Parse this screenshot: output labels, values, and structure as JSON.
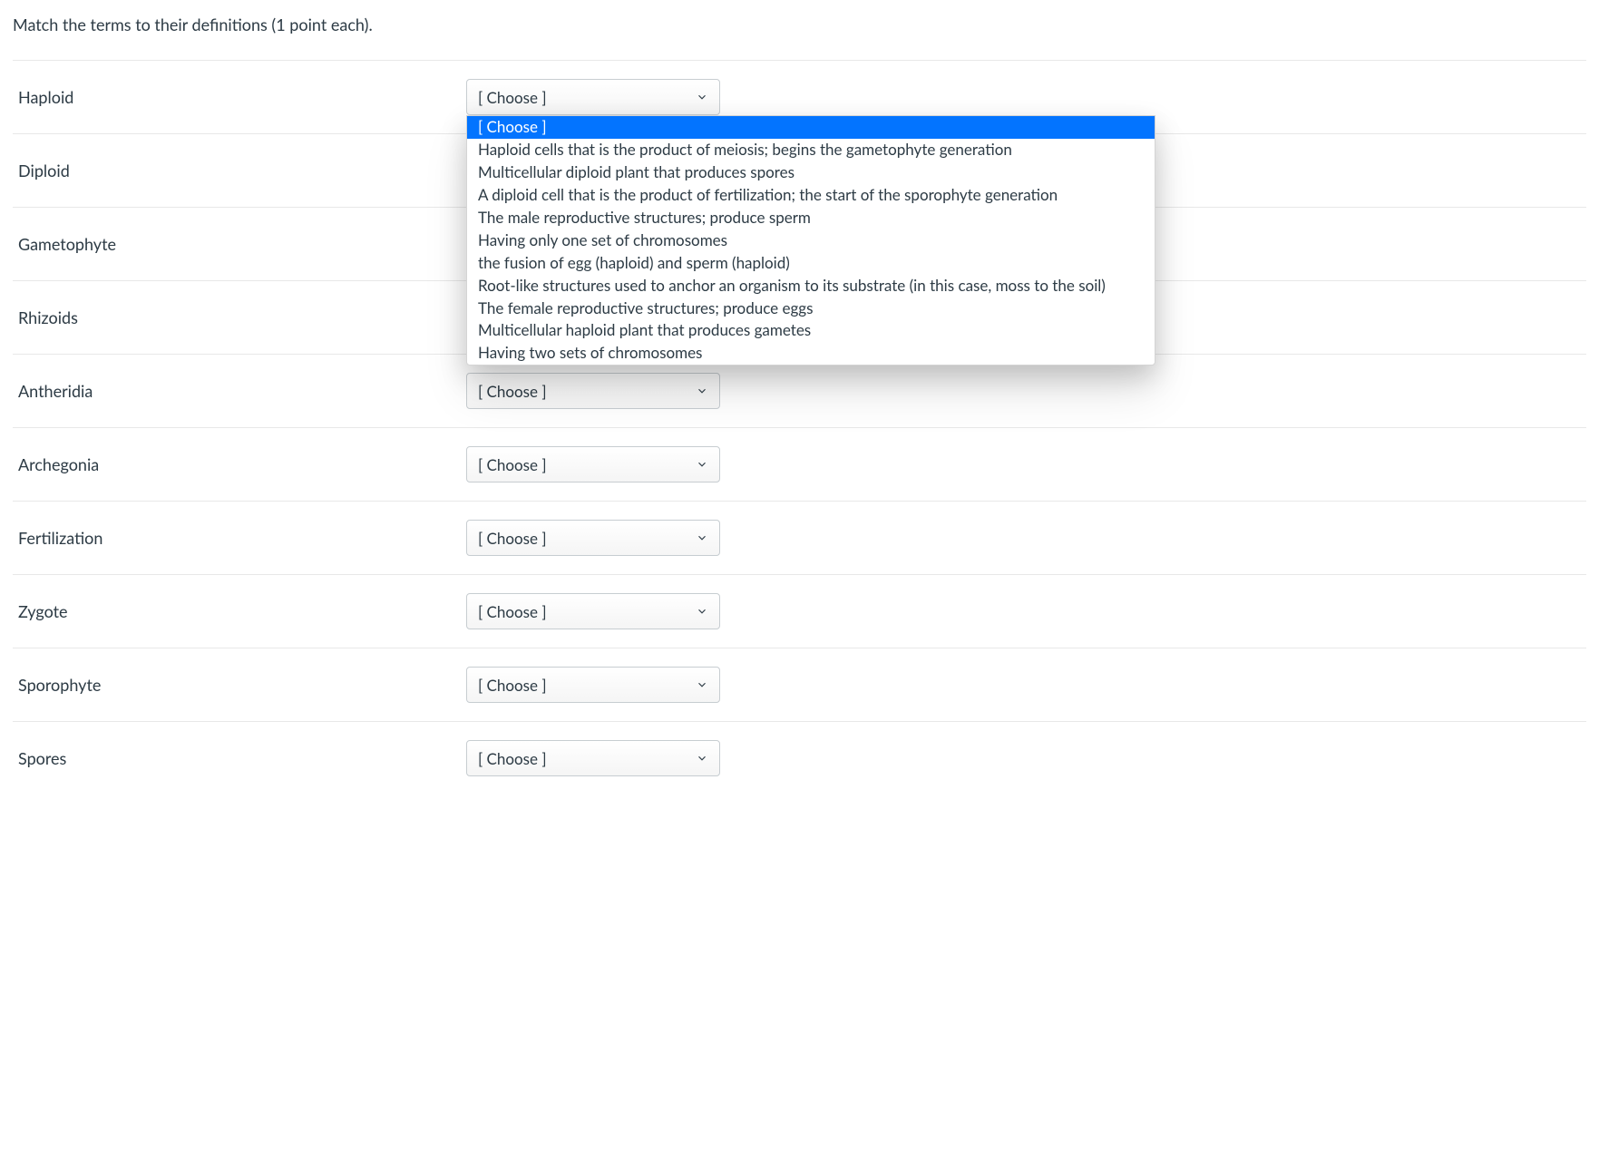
{
  "question": "Match the terms to their definitions (1 point each).",
  "choosePlaceholder": "[ Choose ]",
  "terms": [
    {
      "id": "haploid",
      "label": "Haploid",
      "open": true
    },
    {
      "id": "diploid",
      "label": "Diploid",
      "open": false
    },
    {
      "id": "gametophyte",
      "label": "Gametophyte",
      "open": false
    },
    {
      "id": "rhizoids",
      "label": "Rhizoids",
      "open": false
    },
    {
      "id": "antheridia",
      "label": "Antheridia",
      "open": false
    },
    {
      "id": "archegonia",
      "label": "Archegonia",
      "open": false
    },
    {
      "id": "fertilization",
      "label": "Fertilization",
      "open": false
    },
    {
      "id": "zygote",
      "label": "Zygote",
      "open": false
    },
    {
      "id": "sporophyte",
      "label": "Sporophyte",
      "open": false
    },
    {
      "id": "spores",
      "label": "Spores",
      "open": false
    }
  ],
  "options": [
    "[ Choose ]",
    "Haploid cells that is the product of meiosis; begins the gametophyte generation",
    "Multicellular diploid plant that produces spores",
    "A diploid cell that is the product of fertilization; the start of the sporophyte generation",
    "The male reproductive structures; produce sperm",
    "Having only one set of chromosomes",
    "the fusion of egg (haploid) and sperm (haploid)",
    "Root-like structures used to anchor an organism to its substrate (in this case, moss to the soil)",
    "The female reproductive structures; produce eggs",
    "Multicellular haploid plant that produces gametes",
    "Having two sets of chromosomes"
  ],
  "selectedOptionIndex": 0
}
